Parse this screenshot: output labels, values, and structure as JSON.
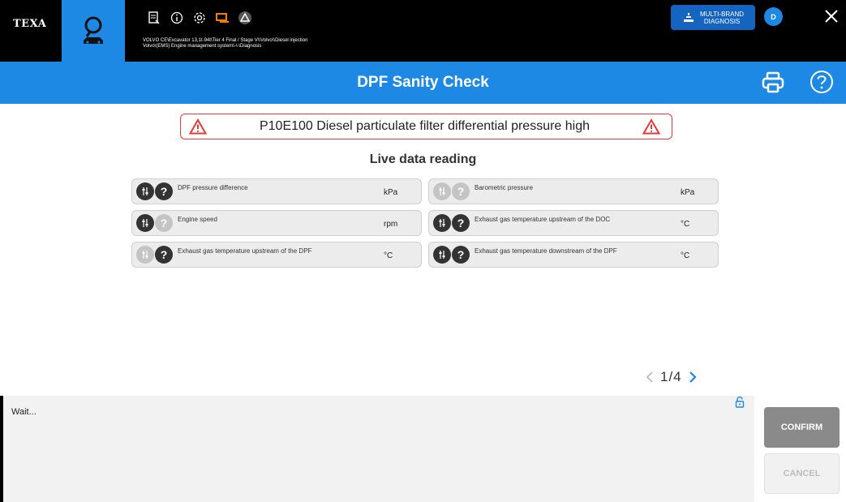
{
  "header": {
    "logo": "TEXA",
    "breadcrumb_line1": "VOLVO CE\\Excavator 13,1t-94t\\Tier 4 Final / Stage V\\\\Volvo\\\\Diesel injection",
    "breadcrumb_line2": "Volvo\\(EMS) Engine management system\\-\\-\\Diagnosis",
    "multibrand_line1": "MULTI-BRAND",
    "multibrand_line2": "DIAGNOSIS",
    "avatar_initial": "D",
    "icons": [
      "search-car-icon",
      "manual-icon",
      "info-icon",
      "settings-icon",
      "screen-icon",
      "triangle-logo-icon",
      "close-icon"
    ]
  },
  "title": "DPF Sanity Check",
  "alert": {
    "text": "P10E100 Diesel particulate filter differential pressure high"
  },
  "live_data_title": "Live data reading",
  "live_data": [
    {
      "label": "DPF pressure difference",
      "unit": "kPa",
      "graph_active": true,
      "help_active": true
    },
    {
      "label": "Barometric pressure",
      "unit": "kPa",
      "graph_active": false,
      "help_active": false
    },
    {
      "label": "Engine speed",
      "unit": "rpm",
      "graph_active": true,
      "help_active": false
    },
    {
      "label": "Exhaust gas temperature upstream of the DOC",
      "unit": "°C",
      "graph_active": true,
      "help_active": true
    },
    {
      "label": "Exhaust gas temperature upstream of the DPF",
      "unit": "°C",
      "graph_active": false,
      "help_active": true
    },
    {
      "label": "Exhaust gas temperature downstream of the DPF",
      "unit": "°C",
      "graph_active": true,
      "help_active": true
    }
  ],
  "pager": {
    "text": "1/4"
  },
  "status": {
    "text": "Wait..."
  },
  "buttons": {
    "confirm": "CONFIRM",
    "cancel": "CANCEL"
  },
  "colors": {
    "brand_blue": "#1e88e5",
    "alert_red": "#e53935",
    "confirm_gray": "#8a8a8a"
  }
}
